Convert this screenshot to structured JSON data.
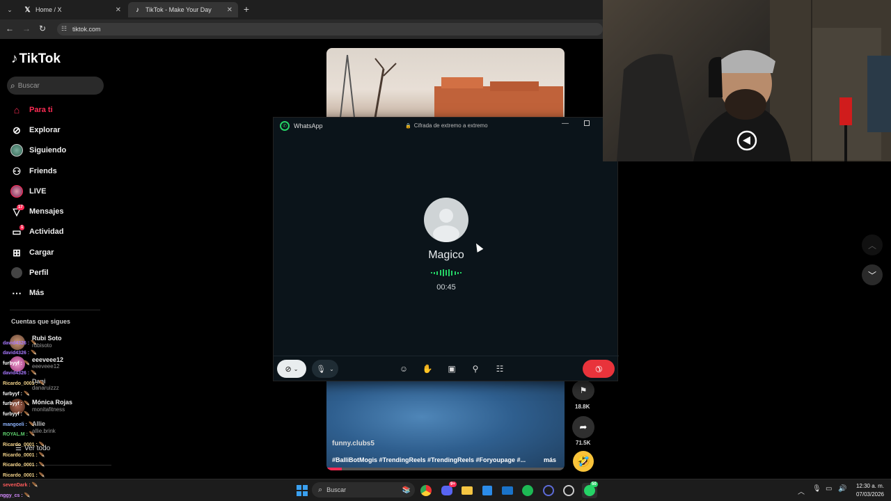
{
  "browser": {
    "tabs": [
      {
        "label": "Home / X",
        "icon": "x-logo-icon",
        "active": false
      },
      {
        "label": "TikTok - Make Your Day",
        "icon": "tiktok-logo-icon",
        "active": true
      }
    ],
    "url": "tiktok.com"
  },
  "tiktok": {
    "brand": "TikTok",
    "search_placeholder": "Buscar",
    "nav": [
      {
        "label": "Para ti",
        "icon": "home-icon",
        "active": true
      },
      {
        "label": "Explorar",
        "icon": "compass-icon"
      },
      {
        "label": "Siguiendo",
        "icon": "avatar-icon"
      },
      {
        "label": "Friends",
        "icon": "friends-icon"
      },
      {
        "label": "LIVE",
        "icon": "live-avatar-icon"
      },
      {
        "label": "Mensajes",
        "icon": "messages-icon",
        "badge": "17"
      },
      {
        "label": "Actividad",
        "icon": "activity-icon",
        "badge": "1"
      },
      {
        "label": "Cargar",
        "icon": "upload-icon"
      },
      {
        "label": "Perfil",
        "icon": "profile-icon"
      },
      {
        "label": "Más",
        "icon": "more-icon"
      }
    ],
    "following_title": "Cuentas que sigues",
    "following": [
      {
        "name": "Rubi Soto",
        "handle": "rubisoto"
      },
      {
        "name": "eeeveee12",
        "handle": "eeeveee12"
      },
      {
        "name": "Dani",
        "handle": "danaruizzz"
      },
      {
        "name": "Mónica Rojas",
        "handle": "monitafitness"
      },
      {
        "name": "Allie",
        "handle": "allie.brink"
      }
    ],
    "see_all": "Ver todo",
    "video": {
      "caption_user": "funny.clubs5",
      "caption_tags": "#BalliBotMogis #TrendingReels #TrendingReels #Foryoupage #...",
      "more": "más",
      "bookmark_count": "18.8K",
      "share_count": "71.5K"
    }
  },
  "chat_overlay": [
    {
      "user": "david4326 :",
      "color": "#a879ff"
    },
    {
      "user": "david4326 :",
      "color": "#a879ff"
    },
    {
      "user": "furbyyf :",
      "color": "#ffffff"
    },
    {
      "user": "david4326 :",
      "color": "#a879ff"
    },
    {
      "user": "Ricardo_0001 :",
      "color": "#f3d38a"
    },
    {
      "user": "furbyyf :",
      "color": "#ffffff"
    },
    {
      "user": "furbyyf :",
      "color": "#ffffff"
    },
    {
      "user": "furbyyf :",
      "color": "#ffffff"
    },
    {
      "user": "mangoeli :",
      "color": "#8fb5ff"
    },
    {
      "user": "ROYAL.M :",
      "color": "#5fd16e"
    },
    {
      "user": "Ricardo_0001 :",
      "color": "#f3d38a"
    },
    {
      "user": "Ricardo_0001 :",
      "color": "#f3d38a"
    },
    {
      "user": "Ricardo_0001 :",
      "color": "#f3d38a"
    },
    {
      "user": "Ricardo_0001 :",
      "color": "#f3d38a"
    },
    {
      "user": "sevenDark :",
      "color": "#ff5b5b"
    },
    {
      "user": "nggy_cs :",
      "color": "#d58aff"
    }
  ],
  "whatsapp": {
    "app_name": "WhatsApp",
    "encryption": "Cifrada de extremo a extremo",
    "contact": "Magico",
    "duration": "00:45",
    "accent": "#25d366",
    "end_color": "#e8333b"
  },
  "taskbar": {
    "search_placeholder": "Buscar",
    "whatsapp_badge": "50",
    "discord_badge": "9+",
    "time": "12:30 a. m.",
    "date": "07/03/2026"
  }
}
